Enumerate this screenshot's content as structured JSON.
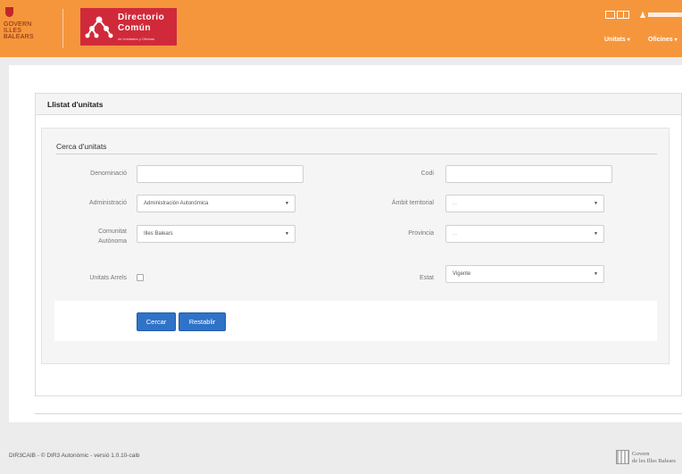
{
  "header": {
    "govern_logo_text": [
      "GOVERN",
      "ILLES",
      "BALEARS"
    ],
    "app_title_line1": "Directorio",
    "app_title_line2": "Común",
    "app_subtitle": "de Unidades y Oficinas",
    "nav": [
      {
        "label": "Unitats"
      },
      {
        "label": "Oficines"
      }
    ]
  },
  "panel": {
    "title": "Llistat d'unitats"
  },
  "search": {
    "legend": "Cerca d'unitats",
    "denominacio_label": "Denominació",
    "denominacio_value": "",
    "codi_label": "Codi",
    "codi_value": "",
    "administracio_label": "Administració",
    "administracio_value": "Administración Autonómica",
    "ambit_label": "Àmbit territorial",
    "ambit_value": "...",
    "comunitat_label_1": "Comunitat",
    "comunitat_label_2": "Autònoma",
    "comunitat_value": "Illes Balears",
    "provincia_label": "Provincia",
    "provincia_value": "...",
    "arrels_label": "Unitats Arrels",
    "arrels_checked": false,
    "estat_label": "Estat",
    "estat_value": "Vigente",
    "search_button": "Cercar",
    "reset_button": "Restablir"
  },
  "footer": {
    "text": "DIR3CAIB - © DIR3 Autonòmic - versió 1.0.10-caib",
    "govern_line1": "Govern",
    "govern_line2": "de les Illes Balears"
  },
  "colors": {
    "header_bg": "#f6963c",
    "logo_red": "#d02a3a",
    "button_blue": "#2f73c8"
  }
}
